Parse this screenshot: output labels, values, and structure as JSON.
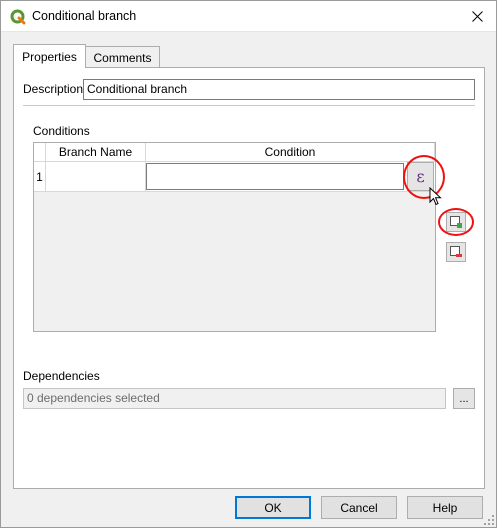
{
  "window": {
    "title": "Conditional branch",
    "app_icon": "qgis-logo-icon",
    "close_icon": "close-icon"
  },
  "tabs": [
    {
      "label": "Properties",
      "active": true
    },
    {
      "label": "Comments",
      "active": false
    }
  ],
  "properties": {
    "description_label": "Description",
    "description_value": "Conditional branch",
    "conditions_label": "Conditions",
    "table": {
      "columns": [
        "Branch Name",
        "Condition"
      ],
      "rows": [
        {
          "number": "1",
          "branch_name": "",
          "condition": ""
        }
      ]
    },
    "expression_button_glyph": "ε",
    "add_row_icon": "add-row-icon",
    "remove_row_icon": "remove-row-icon",
    "dependencies_label": "Dependencies",
    "dependencies_placeholder": "0 dependencies selected",
    "dependencies_button": "..."
  },
  "buttons": {
    "ok": "OK",
    "cancel": "Cancel",
    "help": "Help"
  },
  "colors": {
    "highlight": "#e11111",
    "expression_glyph": "#6b2f8a",
    "default_button_border": "#0078d7"
  }
}
